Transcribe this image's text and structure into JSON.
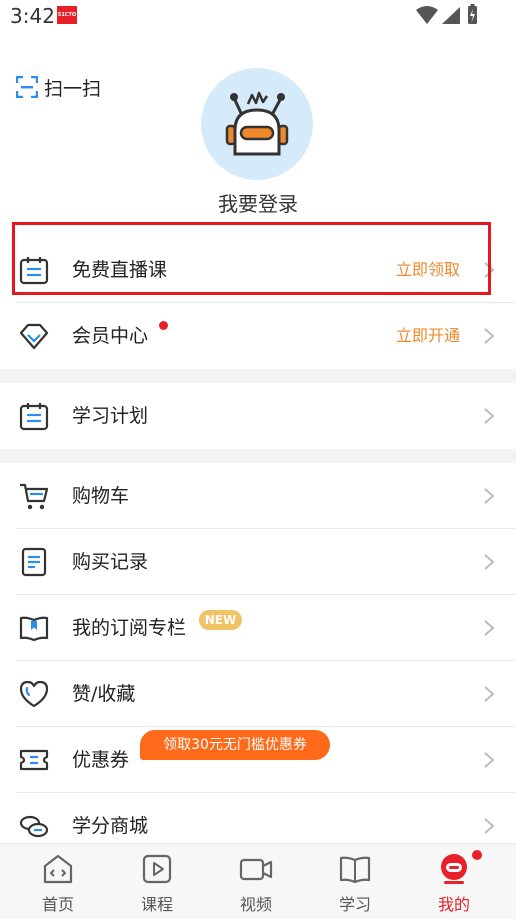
{
  "status": {
    "time": "3:42",
    "logo_text": "51CTO"
  },
  "header": {
    "scan_label": "扫一扫",
    "login_text": "我要登录"
  },
  "menu": {
    "free_live": {
      "label": "免费直播课",
      "action": "立即领取"
    },
    "vip": {
      "label": "会员中心",
      "action": "立即开通"
    },
    "study_plan": {
      "label": "学习计划"
    },
    "cart": {
      "label": "购物车"
    },
    "purchase": {
      "label": "购买记录"
    },
    "subscriptions": {
      "label": "我的订阅专栏",
      "badge": "NEW"
    },
    "likes": {
      "label": "赞/收藏"
    },
    "coupons": {
      "label": "优惠券",
      "tag": "领取30元无门槛优惠券"
    },
    "mall": {
      "label": "学分商城"
    }
  },
  "tabs": [
    {
      "label": "首页",
      "icon": "home-code-icon"
    },
    {
      "label": "课程",
      "icon": "play-icon"
    },
    {
      "label": "视频",
      "icon": "video-camera-icon"
    },
    {
      "label": "学习",
      "icon": "book-icon"
    },
    {
      "label": "我的",
      "icon": "profile-robot-icon",
      "active": true
    }
  ],
  "colors": {
    "accent": "#e8202a",
    "action": "#f0892c",
    "icon_blue": "#2d8cf0",
    "coupon": "#ff6a1a",
    "badge": "#f2c267"
  }
}
